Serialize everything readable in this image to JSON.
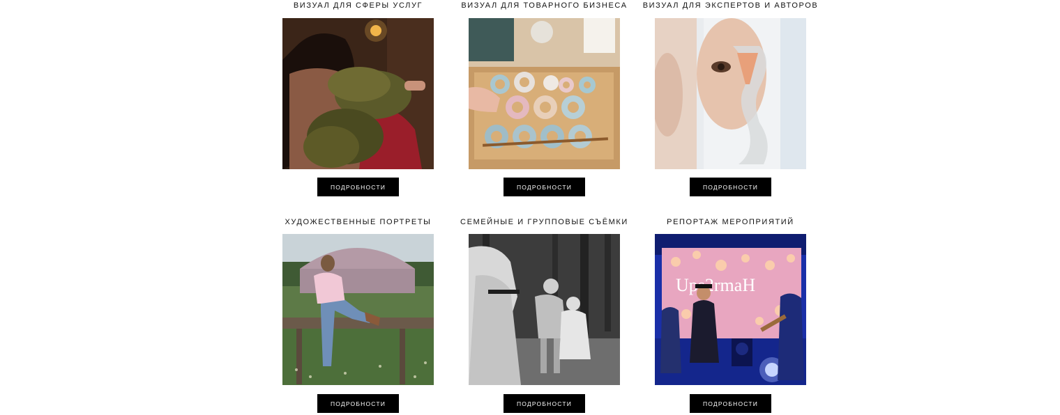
{
  "services": [
    {
      "title": "ВИЗУАЛ ДЛЯ СФЕРЫ УСЛУГ",
      "button": "ПОДРОБНОСТИ",
      "image": "photo of a woman in a sauna with a birch besom"
    },
    {
      "title": "ВИЗУАЛ ДЛЯ ТОВАРНОГО БИЗНЕСА",
      "button": "ПОДРОБНОСТИ",
      "image": "flat lay of a wooden drawer with pastel ceramic rings"
    },
    {
      "title": "ВИЗУАЛ ДЛЯ ЭКСПЕРТОВ И АВТОРОВ",
      "button": "ПОДРОБНОСТИ",
      "image": "blurred portrait of a woman behind an hourglass"
    },
    {
      "title": "ХУДОЖЕСТВЕННЫЕ ПОРТРЕТЫ",
      "button": "ПОДРОБНОСТИ",
      "image": "woman sitting on a bench in front of a yurt"
    },
    {
      "title": "СЕМЕЙНЫЕ И ГРУППОВЫЕ СЪЁМКИ",
      "button": "ПОДРОБНОСТИ",
      "image": "black and white photo of a mother with two children in a forest"
    },
    {
      "title": "РЕПОРТАЖ МЕРОПРИЯТИЙ",
      "button": "ПОДРОБНОСТИ",
      "image": "band performing on a blue lit stage"
    }
  ],
  "stage_sign": "Ups2rmaH",
  "colors": {
    "button_bg": "#000000",
    "button_text": "#ffffff",
    "title_text": "#111111",
    "page_bg": "#ffffff"
  }
}
